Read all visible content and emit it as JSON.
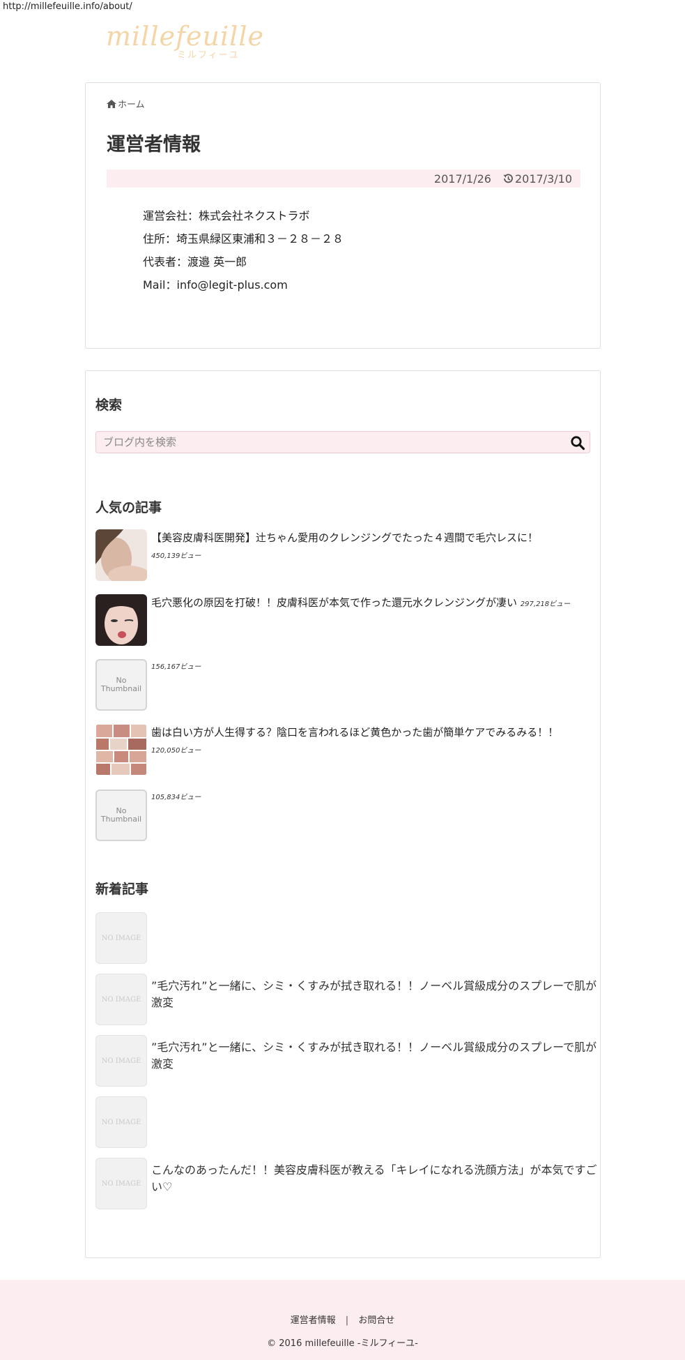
{
  "url": "http://millefeuille.info/about/",
  "logo": {
    "word": "millefeuille",
    "kana": "ミルフィーユ"
  },
  "breadcrumb": {
    "home_label": "ホーム"
  },
  "page": {
    "title": "運営者情報",
    "published": "2017/1/26",
    "updated": "2017/3/10",
    "info": [
      "運営会社：株式会社ネクストラボ",
      "住所：埼玉県緑区東浦和３－２８－２８",
      "代表者：渡邉 英一郎",
      "Mail：info@legit-plus.com"
    ]
  },
  "search": {
    "title": "検索",
    "placeholder": "ブログ内を検索"
  },
  "popular": {
    "title": "人気の記事",
    "items": [
      {
        "title": "【美容皮膚科医開発】辻ちゃん愛用のクレンジングでたった４週間で毛穴レスに！",
        "views": "450,139ビュー"
      },
      {
        "title": "毛穴悪化の原因を打破！！皮膚科医が本気で作った還元水クレンジングが凄い",
        "views": "297,218ビュー"
      },
      {
        "title": "",
        "views": "156,167ビュー",
        "thumb": "No Thumbnail"
      },
      {
        "title": "歯は白い方が人生得する？陰口を言われるほど黄色かった歯が簡単ケアでみるみる！！",
        "views": "120,050ビュー"
      },
      {
        "title": "",
        "views": "105,834ビュー",
        "thumb": "No Thumbnail"
      }
    ]
  },
  "recent": {
    "title": "新着記事",
    "no_image": "NO IMAGE",
    "items": [
      {
        "title": ""
      },
      {
        "title": "”毛穴汚れ”と一緒に、シミ・くすみが拭き取れる！！ノーベル賞級成分のスプレーで肌が激変"
      },
      {
        "title": "”毛穴汚れ”と一緒に、シミ・くすみが拭き取れる！！ノーベル賞級成分のスプレーで肌が激変"
      },
      {
        "title": ""
      },
      {
        "title": "こんなのあったんだ！！美容皮膚科医が教える「キレイになれる洗顔方法」が本気ですごい♡"
      }
    ]
  },
  "footer": {
    "link_about": "運営者情報",
    "separator": "|",
    "link_contact": "お問合せ",
    "copyright": "© 2016 millefeuille -ミルフィーユ-"
  },
  "colors": {
    "accent_pink": "#fcedf0",
    "logo": "#f5d4a6",
    "border": "#e4dcdc"
  }
}
